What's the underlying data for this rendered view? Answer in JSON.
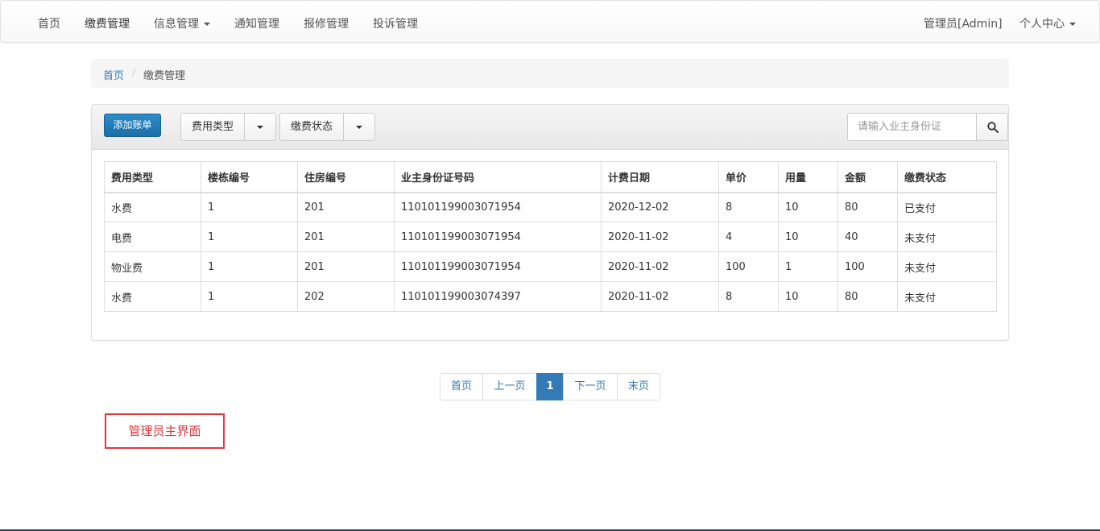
{
  "navbar": {
    "items": [
      {
        "label": "首页"
      },
      {
        "label": "缴费管理"
      },
      {
        "label": "信息管理"
      },
      {
        "label": "通知管理"
      },
      {
        "label": "报修管理"
      },
      {
        "label": "投诉管理"
      }
    ],
    "admin_label": "管理员[Admin]",
    "profile_label": "个人中心"
  },
  "breadcrumb": {
    "home": "首页",
    "separator": "/",
    "current": "缴费管理"
  },
  "toolbar": {
    "add_label": "添加账单",
    "fee_type_label": "费用类型",
    "status_label": "缴费状态",
    "search_placeholder": "请输入业主身份证"
  },
  "table": {
    "headers": [
      "费用类型",
      "楼栋编号",
      "住房编号",
      "业主身份证号码",
      "计费日期",
      "单价",
      "用量",
      "金额",
      "缴费状态"
    ],
    "rows": [
      [
        "水费",
        "1",
        "201",
        "110101199003071954",
        "2020-12-02",
        "8",
        "10",
        "80",
        "已支付"
      ],
      [
        "电费",
        "1",
        "201",
        "110101199003071954",
        "2020-11-02",
        "4",
        "10",
        "40",
        "未支付"
      ],
      [
        "物业费",
        "1",
        "201",
        "110101199003071954",
        "2020-11-02",
        "100",
        "1",
        "100",
        "未支付"
      ],
      [
        "水费",
        "1",
        "202",
        "110101199003074397",
        "2020-11-02",
        "8",
        "10",
        "80",
        "未支付"
      ]
    ]
  },
  "pagination": {
    "first": "首页",
    "prev": "上一页",
    "current": "1",
    "next": "下一页",
    "last": "末页"
  },
  "caption": "管理员主界面",
  "colors": {
    "primary": "#337ab7",
    "caption_red": "#e0383e"
  }
}
